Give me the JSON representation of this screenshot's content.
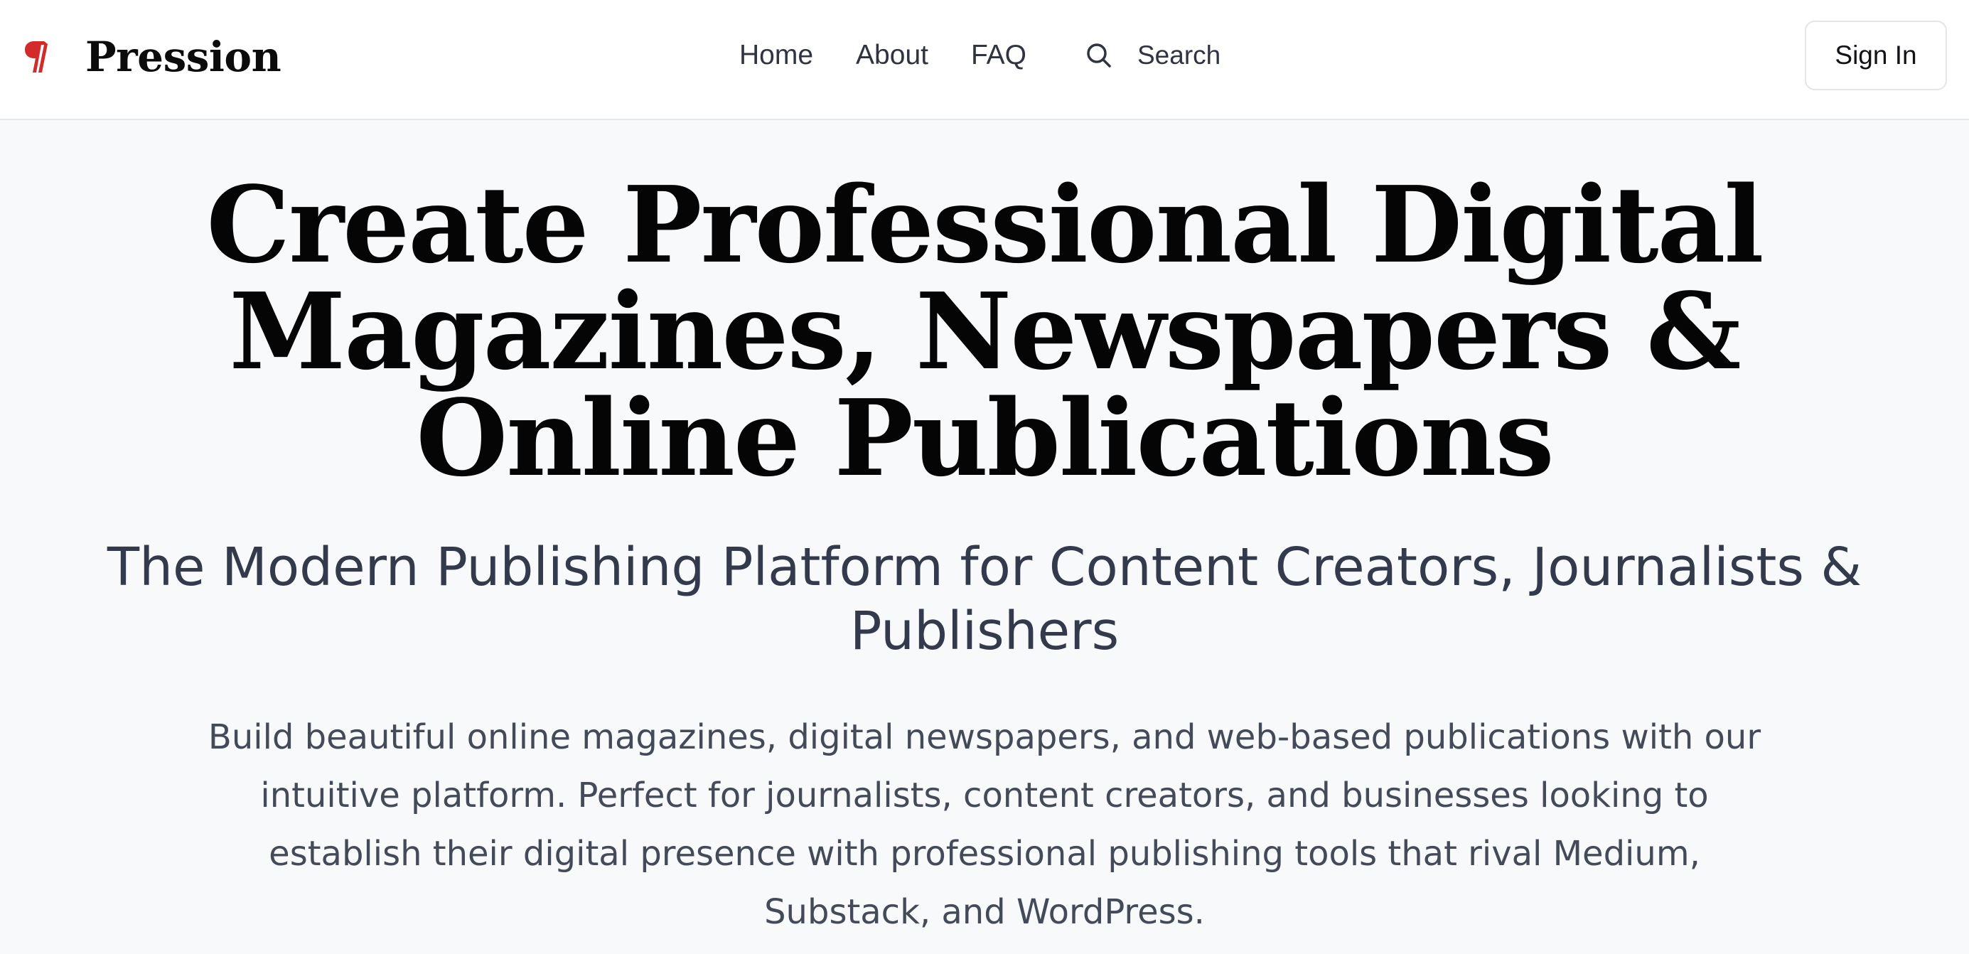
{
  "brand": {
    "name": "Pression",
    "logo_icon": "pilcrow-icon",
    "accent_color": "#d32a2a"
  },
  "nav": {
    "items": [
      {
        "label": "Home"
      },
      {
        "label": "About"
      },
      {
        "label": "FAQ"
      }
    ],
    "search": {
      "icon": "search-icon",
      "label": "Search"
    }
  },
  "header": {
    "signin_label": "Sign In"
  },
  "hero": {
    "title": "Create Professional Digital Magazines, Newspapers & Online Publications",
    "subtitle": "The Modern Publishing Platform for Content Creators, Journalists & Publishers",
    "body": "Build beautiful online magazines, digital newspapers, and web-based publications with our intuitive platform. Perfect for journalists, content creators, and businesses looking to establish their digital presence with professional publishing tools that rival Medium, Substack, and WordPress."
  }
}
